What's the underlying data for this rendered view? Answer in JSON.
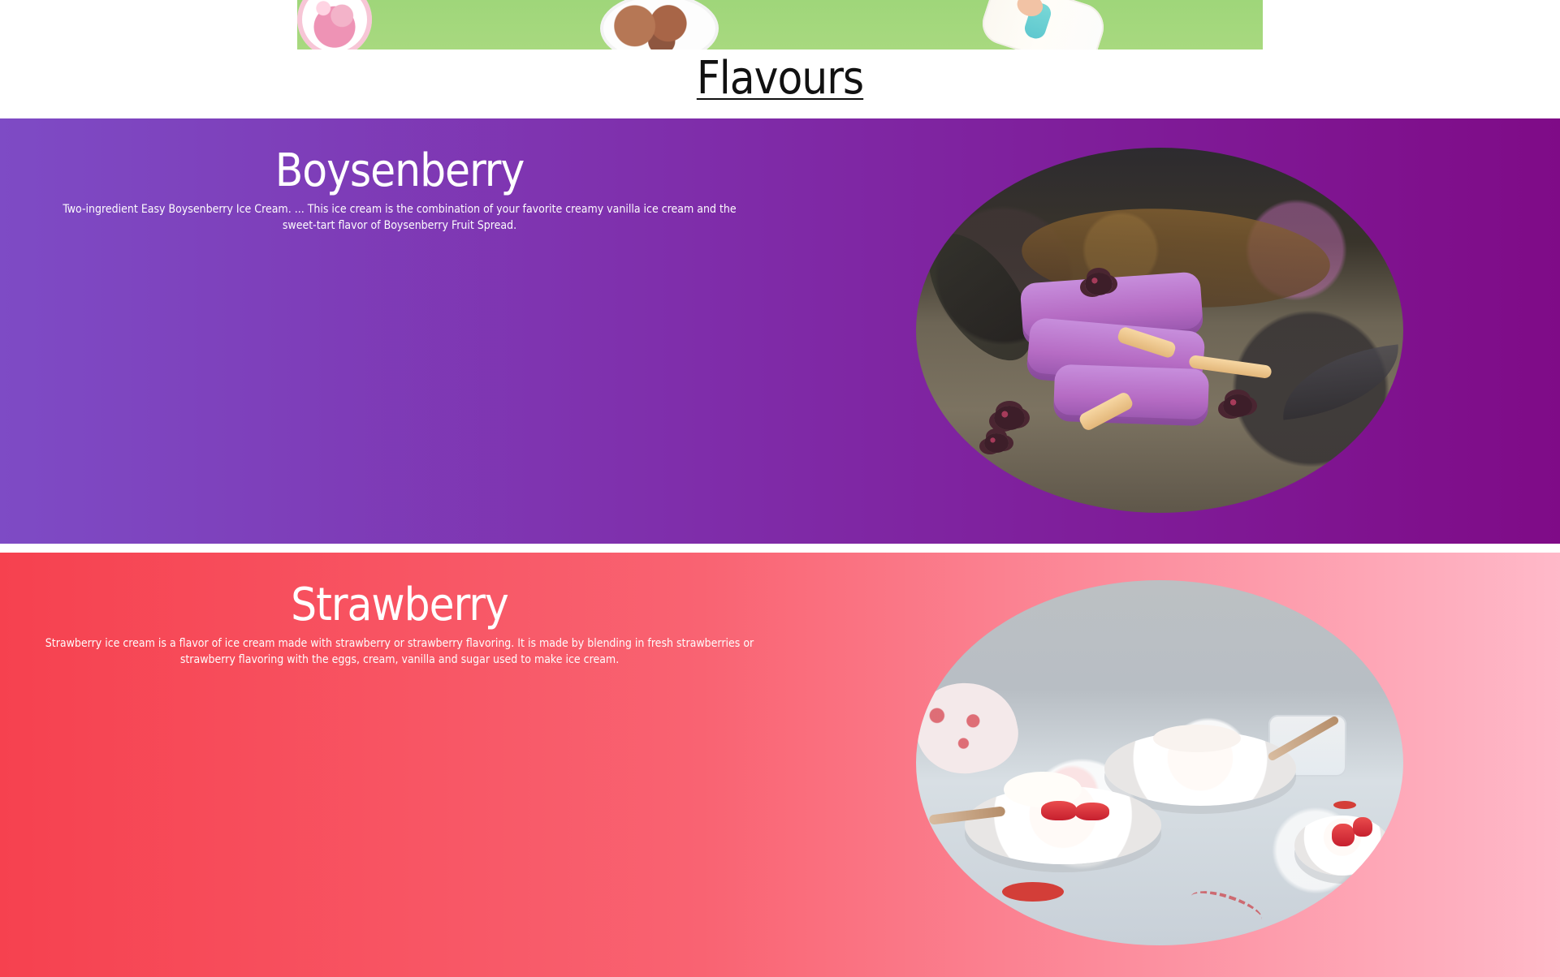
{
  "page": {
    "section_title": "Flavours"
  },
  "flavors": [
    {
      "title": "Boysenberry",
      "description": "Two-ingredient Easy Boysenberry Ice Cream. ... This ice cream is the combination of your favorite creamy vanilla ice cream and the sweet-tart flavor of Boysenberry Fruit Spread."
    },
    {
      "title": "Strawberry",
      "description": "Strawberry ice cream is a flavor of ice cream made with strawberry or strawberry flavoring. It is made by blending in fresh strawberries or strawberry flavoring with the eggs, cream, vanilla and sugar used to make ice cream."
    }
  ]
}
